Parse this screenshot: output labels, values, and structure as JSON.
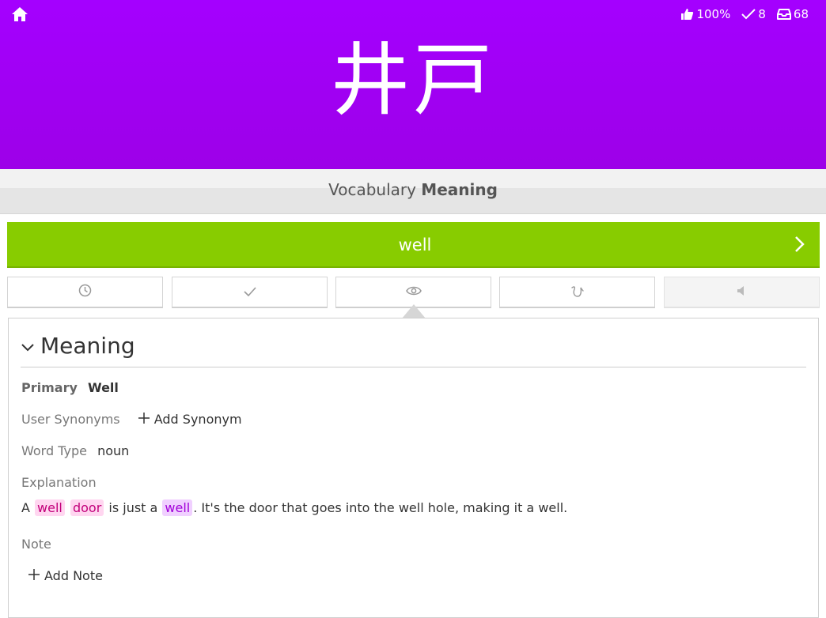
{
  "header": {
    "stats": {
      "percent": "100%",
      "done": "8",
      "queue": "68"
    },
    "kanji": "井戸"
  },
  "prompt": {
    "type": "Vocabulary",
    "mode": "Meaning"
  },
  "answer": {
    "value": "well"
  },
  "info": {
    "title": "Meaning",
    "primary_label": "Primary",
    "primary_value": "Well",
    "synonyms_label": "User Synonyms",
    "add_synonym": "Add Synonym",
    "word_type_label": "Word Type",
    "word_type_value": "noun",
    "explanation_label": "Explanation",
    "explanation": {
      "p1": "A",
      "r1": "well",
      "r2": "door",
      "p2": "is just a",
      "v1": "well",
      "p3": ". It's the door that goes into the well hole, making it a well."
    },
    "note_label": "Note",
    "add_note": "Add Note"
  },
  "colors": {
    "hero": "#a400ff",
    "answer_correct": "#88cc00"
  }
}
